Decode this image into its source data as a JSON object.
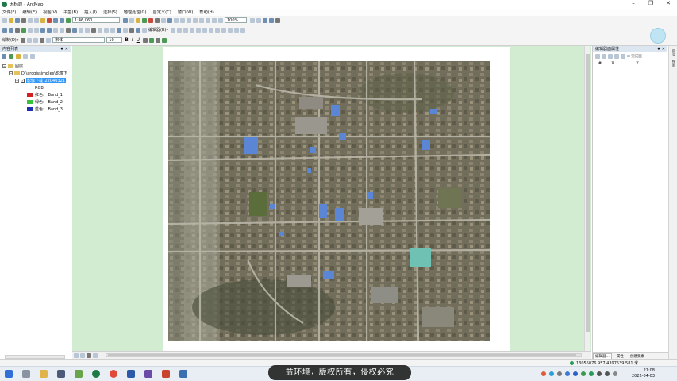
{
  "window": {
    "title": "无标题 - ArcMap",
    "controls": [
      "–",
      "❐",
      "✕"
    ]
  },
  "menu": [
    "文件(F)",
    "编辑(E)",
    "视图(V)",
    "书签(B)",
    "插入(I)",
    "选择(S)",
    "地理处理(G)",
    "自定义(C)",
    "窗口(W)",
    "帮助(H)"
  ],
  "toolbar": {
    "scale": "1:46,060",
    "zoom": "100%",
    "editor_label": "编辑器(R)▾",
    "draw_label": "绘制(D)▾",
    "font_name": "宋体",
    "font_size": "10",
    "bold": "B",
    "italic": "I",
    "underline": "U"
  },
  "toc": {
    "title": "内容列表",
    "pin": "♦ ✕",
    "layers_root": "图层",
    "folder_path": "D:\\arcgissimples\\影像下",
    "layer_name": "影像下载_22040321",
    "rgb_label": "RGB",
    "bands": [
      {
        "label": "红色:",
        "band": "Band_1",
        "color": "#d62020"
      },
      {
        "label": "绿色:",
        "band": "Band_2",
        "color": "#36c23a"
      },
      {
        "label": "蓝色:",
        "band": "Band_3",
        "color": "#1e2fb4"
      }
    ]
  },
  "editor_panel": {
    "title": "编辑器面属性",
    "pin": "♦ ✕",
    "tool_hint": "⊡ 完成面",
    "columns": [
      "#",
      "X",
      "Y"
    ],
    "tabs": [
      "编辑器...",
      "属性",
      "创建要素"
    ]
  },
  "side_strip": [
    "目录",
    "搜索"
  ],
  "status": {
    "coords": "13055076.957  4397539.581 米"
  },
  "taskbar": {
    "time": "21:08",
    "date": "2022-04-03"
  },
  "caption": "益环境，版权所有，侵权必究",
  "colors": {
    "map_bg": "#d2ecd2",
    "selected": "#3399ff",
    "panel_head": "#dce6f1"
  }
}
